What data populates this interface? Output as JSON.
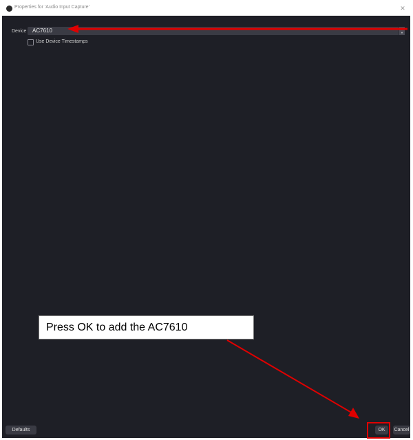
{
  "window": {
    "title": "Properties for 'Audio Input Capture'",
    "close_glyph": "✕"
  },
  "form": {
    "device_label": "Device",
    "device_value": "AC7610",
    "timestamps_label": "Use Device Timestamps",
    "timestamps_checked": false
  },
  "buttons": {
    "defaults": "Defaults",
    "ok": "OK",
    "cancel": "Cancel"
  },
  "annotation": {
    "callout_text": "Press OK to add the AC7610",
    "arrow_color": "#e00000"
  },
  "theme": {
    "content_bg": "#1e1f26",
    "control_bg": "#3a3b44"
  }
}
